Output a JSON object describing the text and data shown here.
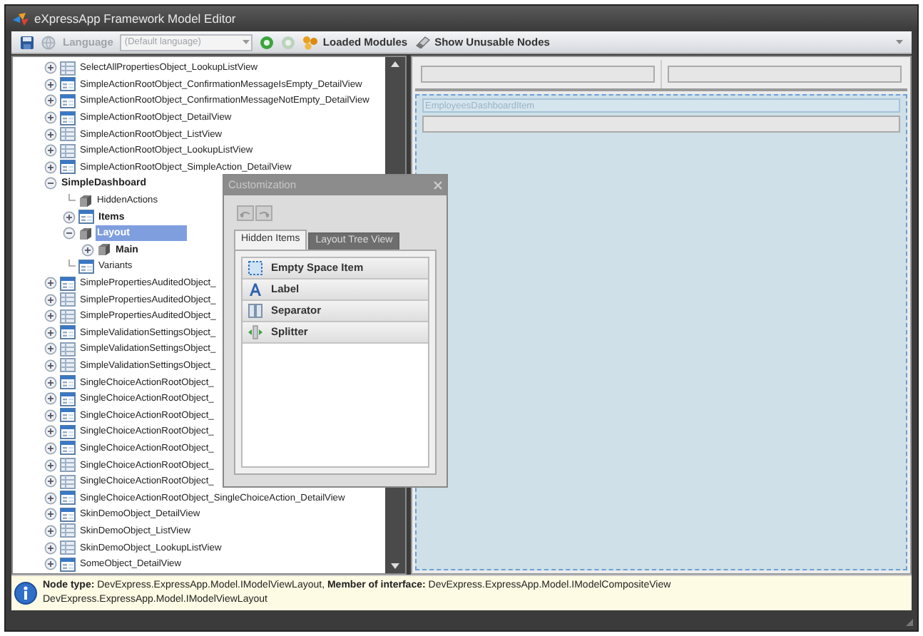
{
  "window": {
    "title": "eXpressApp Framework Model Editor"
  },
  "toolbar": {
    "language_label": "Language",
    "language_disabled": true,
    "language_value": "(Default language)",
    "loaded_modules": "Loaded Modules",
    "show_unusable": "Show Unusable Nodes"
  },
  "tree": [
    {
      "label": "SelectAllPropertiesObject_LookupListView",
      "kind": "list",
      "expanded": false
    },
    {
      "label": "SimpleActionRootObject_ConfirmationMessageIsEmpty_DetailView",
      "kind": "detail",
      "expanded": false
    },
    {
      "label": "SimpleActionRootObject_ConfirmationMessageNotEmpty_DetailView",
      "kind": "detail",
      "expanded": false
    },
    {
      "label": "SimpleActionRootObject_DetailView",
      "kind": "detail",
      "expanded": false
    },
    {
      "label": "SimpleActionRootObject_ListView",
      "kind": "list",
      "expanded": false
    },
    {
      "label": "SimpleActionRootObject_LookupListView",
      "kind": "list",
      "expanded": false
    },
    {
      "label": "SimpleActionRootObject_SimpleAction_DetailView",
      "kind": "detail",
      "expanded": false
    },
    {
      "label": "SimpleDashboard",
      "kind": "none",
      "bold": true,
      "expanded": true,
      "children": [
        {
          "label": "HiddenActions",
          "kind": "cube"
        },
        {
          "label": "Items",
          "kind": "detail",
          "bold": true,
          "expanded": false
        },
        {
          "label": "Layout",
          "kind": "cube",
          "bold": true,
          "selected": true,
          "expanded": true,
          "children": [
            {
              "label": "Main",
              "kind": "cube",
              "bold": true,
              "expanded": false
            }
          ]
        },
        {
          "label": "Variants",
          "kind": "detail"
        }
      ]
    },
    {
      "label": "SimplePropertiesAuditedObject_",
      "kind": "detail",
      "expanded": false
    },
    {
      "label": "SimplePropertiesAuditedObject_",
      "kind": "list",
      "expanded": false
    },
    {
      "label": "SimplePropertiesAuditedObject_",
      "kind": "list",
      "expanded": false
    },
    {
      "label": "SimpleValidationSettingsObject_",
      "kind": "detail",
      "expanded": false
    },
    {
      "label": "SimpleValidationSettingsObject_",
      "kind": "list",
      "expanded": false
    },
    {
      "label": "SimpleValidationSettingsObject_",
      "kind": "list",
      "expanded": false
    },
    {
      "label": "SingleChoiceActionRootObject_",
      "kind": "detail",
      "expanded": false
    },
    {
      "label": "SingleChoiceActionRootObject_",
      "kind": "detail",
      "expanded": false
    },
    {
      "label": "SingleChoiceActionRootObject_",
      "kind": "detail",
      "expanded": false
    },
    {
      "label": "SingleChoiceActionRootObject_",
      "kind": "detail",
      "expanded": false
    },
    {
      "label": "SingleChoiceActionRootObject_",
      "kind": "detail",
      "expanded": false
    },
    {
      "label": "SingleChoiceActionRootObject_",
      "kind": "list",
      "expanded": false
    },
    {
      "label": "SingleChoiceActionRootObject_",
      "kind": "list",
      "expanded": false
    },
    {
      "label": "SingleChoiceActionRootObject_SingleChoiceAction_DetailView",
      "kind": "detail",
      "expanded": false
    },
    {
      "label": "SkinDemoObject_DetailView",
      "kind": "detail",
      "expanded": false
    },
    {
      "label": "SkinDemoObject_ListView",
      "kind": "list",
      "expanded": false
    },
    {
      "label": "SkinDemoObject_LookupListView",
      "kind": "list",
      "expanded": false
    },
    {
      "label": "SomeObject_DetailView",
      "kind": "detail",
      "expanded": false
    }
  ],
  "designer": {
    "group_caption": "EmployeesDashboardItem"
  },
  "customization": {
    "title": "Customization",
    "tabs": [
      {
        "label": "Hidden Items",
        "selected": true
      },
      {
        "label": "Layout Tree View",
        "selected": false
      }
    ],
    "items": [
      {
        "label": "Empty Space Item",
        "kind": "empty"
      },
      {
        "label": "Label",
        "kind": "label"
      },
      {
        "label": "Separator",
        "kind": "separator"
      },
      {
        "label": "Splitter",
        "kind": "splitter"
      }
    ]
  },
  "status": {
    "lines": [
      "**Node type:** DevExpress.ExpressApp.Model.IModelViewLayout,  **Member of interface:** DevExpress.ExpressApp.Model.IModelCompositeView",
      "DevExpress.ExpressApp.Model.IModelViewLayout"
    ]
  }
}
